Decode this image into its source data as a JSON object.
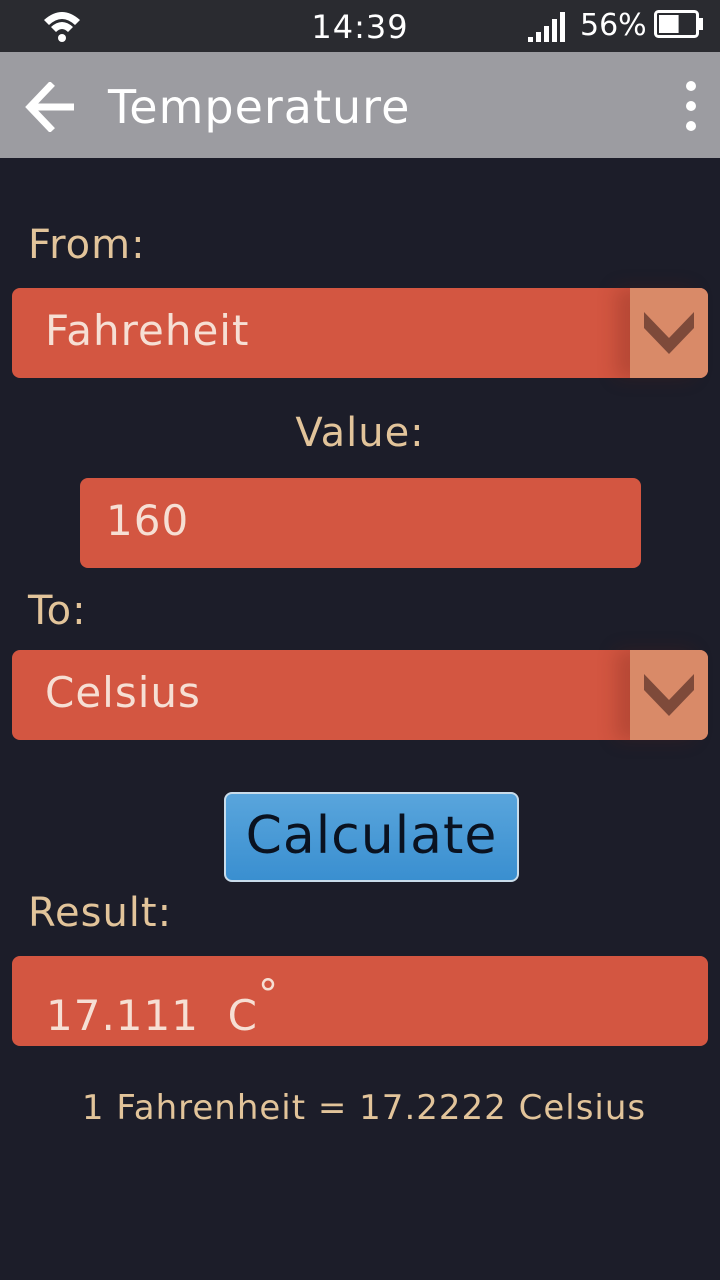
{
  "status_bar": {
    "time": "14:39",
    "battery_percent": "56%",
    "battery_level": 0.56,
    "icons": [
      "wifi-icon",
      "signal-icon",
      "battery-icon"
    ]
  },
  "app_bar": {
    "title": "Temperature",
    "icons": [
      "back-arrow-icon",
      "more-vert-icon"
    ]
  },
  "form": {
    "from_label": "From:",
    "from_value": "Fahreheit",
    "value_label": "Value:",
    "value_input": "160",
    "to_label": "To:",
    "to_value": "Celsius",
    "calculate_label": "Calculate",
    "result_label": "Result:",
    "result_value": "17.111  C",
    "result_unit_mark": "°"
  },
  "info": {
    "conversion_text": "1 Fahrenheit = 17.2222 Celsius"
  },
  "colors": {
    "background": "#1c1d29",
    "field": "#d35641",
    "arrow_box": "#d98a68",
    "label": "#e2c49a",
    "app_bar": "#9c9ca1",
    "button": "#4a9ad6"
  }
}
